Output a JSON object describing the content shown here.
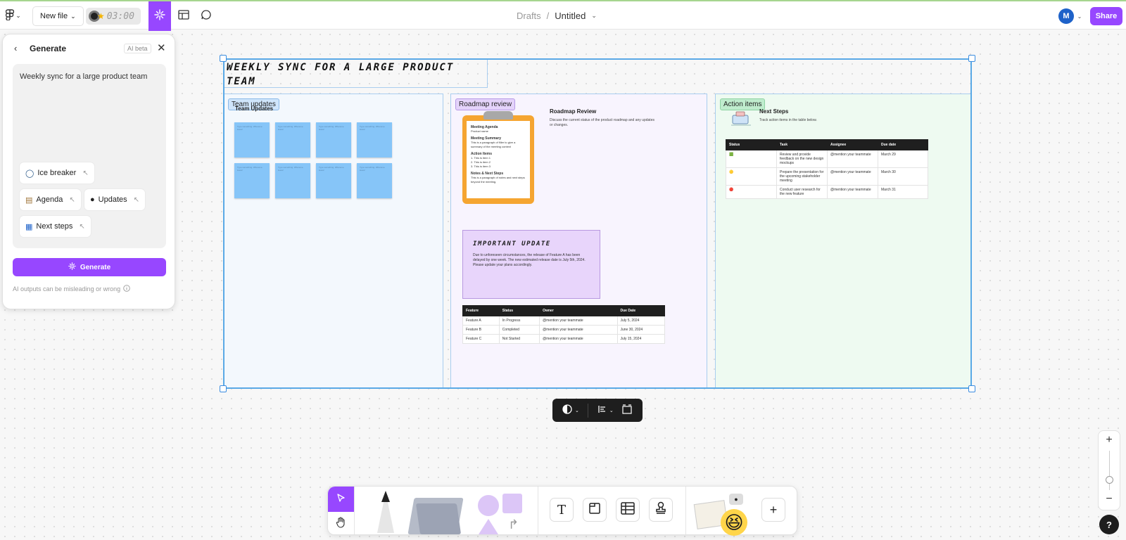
{
  "topbar": {
    "logo_icon": "figma-logo-icon",
    "logo_chevron": "⌄",
    "new_file_label": "New file",
    "new_file_chevron": "⌄",
    "timer_value": "03:00",
    "breadcrumb_parent": "Drafts",
    "breadcrumb_sep": "/",
    "file_name": "Untitled",
    "file_chevron": "⌄",
    "avatar_initial": "M",
    "share_label": "Share"
  },
  "panel": {
    "title": "Generate",
    "badge": "AI beta",
    "prompt": "Weekly sync for a large product team",
    "chips": [
      {
        "icon": "◯",
        "label": "Ice breaker"
      },
      {
        "icon": "▤",
        "label": "Agenda"
      },
      {
        "icon": "●",
        "label": "Updates"
      },
      {
        "icon": "▦",
        "label": "Next steps"
      }
    ],
    "chip_arrow": "↖",
    "generate_label": "Generate",
    "disclaimer": "AI outputs can be misleading or wrong"
  },
  "board": {
    "title": "WEEKLY SYNC FOR A LARGE PRODUCT TEAM",
    "sections": [
      {
        "tag": "Team updates",
        "subtitle": "Team Updates"
      },
      {
        "tag": "Roadmap review"
      },
      {
        "tag": "Action items"
      }
    ],
    "sticky_note_text": "Type something. Wheneve. leave!",
    "roadmap": {
      "agenda_title": "Meeting Agenda",
      "agenda_sub": "Product name",
      "agenda_h1": "Meeting Summary",
      "agenda_t1": "This is a paragraph of filler to give a summary of the meeting context",
      "agenda_h2": "Action Items",
      "agenda_items": [
        "1. This is item 1",
        "2. This is item 2",
        "3. This is item 3"
      ],
      "agenda_h3": "Notes & Next Steps",
      "agenda_t3": "This is a paragraph of notes and next steps beyond the meeting.",
      "title": "Roadmap Review",
      "text": "Discuss the current status of the product roadmap and any updates or changes.",
      "important_title": "IMPORTANT UPDATE",
      "important_text": "Due to unforeseen circumstances, the release of Feature A has been delayed by one week. The new estimated release date is July 5th, 2024. Please update your plans accordingly.",
      "table_headers": [
        "Feature",
        "Status",
        "Owner",
        "Due Date"
      ],
      "table_rows": [
        [
          "Feature A",
          "In Progress",
          "@mention your teammate",
          "July 5, 2024"
        ],
        [
          "Feature B",
          "Completed",
          "@mention your teammate",
          "June 30, 2024"
        ],
        [
          "Feature C",
          "Not Started",
          "@mention your teammate",
          "July 15, 2024"
        ]
      ]
    },
    "action_items": {
      "title": "Next Steps",
      "text": "Track action items in the table below.",
      "table_headers": [
        "Status",
        "Task",
        "Assignee",
        "Due date"
      ],
      "table_rows": [
        [
          "🟩",
          "Review and provide feedback on the new design mockups",
          "@mention your teammate",
          "March 29"
        ],
        [
          "🟡",
          "Prepare the presentation for the upcoming stakeholder meeting",
          "@mention your teammate",
          "March 30"
        ],
        [
          "🔴",
          "Conduct user research for the new feature",
          "@mention your teammate",
          "March 31"
        ]
      ]
    }
  },
  "colors": {
    "accent": "#9747ff",
    "selection": "#5aa9e6",
    "sticky": "#86c5f8",
    "clipboard": "#f5a531"
  },
  "icons": {
    "ai": "ai-sparkle-icon",
    "table": "table-icon",
    "comment": "comment-icon",
    "move": "cursor-arrow-icon",
    "hand": "hand-icon",
    "text": "text-tool-icon",
    "section": "section-tool-icon",
    "table_tool": "table-tool-icon",
    "stamp": "stamp-tool-icon",
    "add": "plus-icon",
    "zoom_in": "plus-icon",
    "zoom_out": "minus-icon",
    "help": "help-icon"
  },
  "bottombar": {
    "text_tool": "T",
    "add": "+"
  },
  "help_label": "?"
}
